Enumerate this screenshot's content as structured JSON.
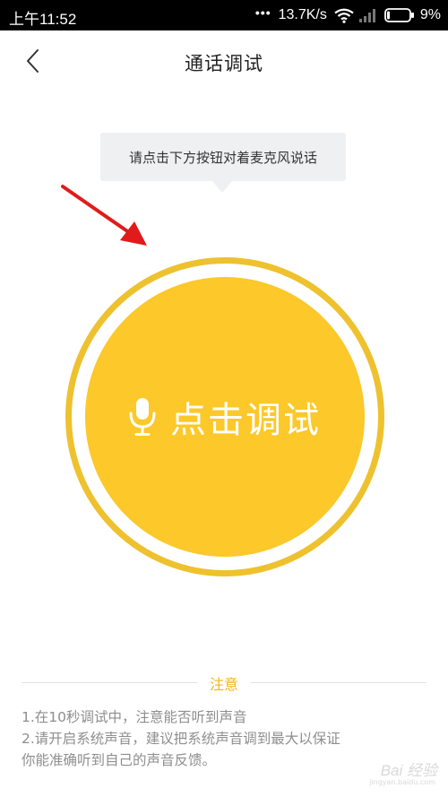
{
  "status_bar": {
    "time": "上午11:52",
    "dots": "•••",
    "speed": "13.7K/s",
    "battery": "9%"
  },
  "header": {
    "title": "通话调试"
  },
  "tooltip": {
    "text": "请点击下方按钮对着麦克风说话"
  },
  "main": {
    "button_label": "点击调试"
  },
  "notice": {
    "title": "注意",
    "items": [
      "1.在10秒调试中，注意能否听到声音",
      "2.请开启系统声音，建议把系统声音调到最大以保证",
      "你能准确听到自己的声音反馈。"
    ]
  },
  "watermark": {
    "text": "Bai 经验",
    "sub": "jingyan.baidu.com"
  },
  "colors": {
    "accent": "#fcc82a",
    "ring": "#eec12e",
    "notice_title": "#f2b61c",
    "annotation_arrow": "#e11b1b"
  },
  "icons": [
    "back-icon",
    "microphone-icon",
    "wifi-icon",
    "signal-icon",
    "battery-icon",
    "red-arrow-annotation"
  ]
}
